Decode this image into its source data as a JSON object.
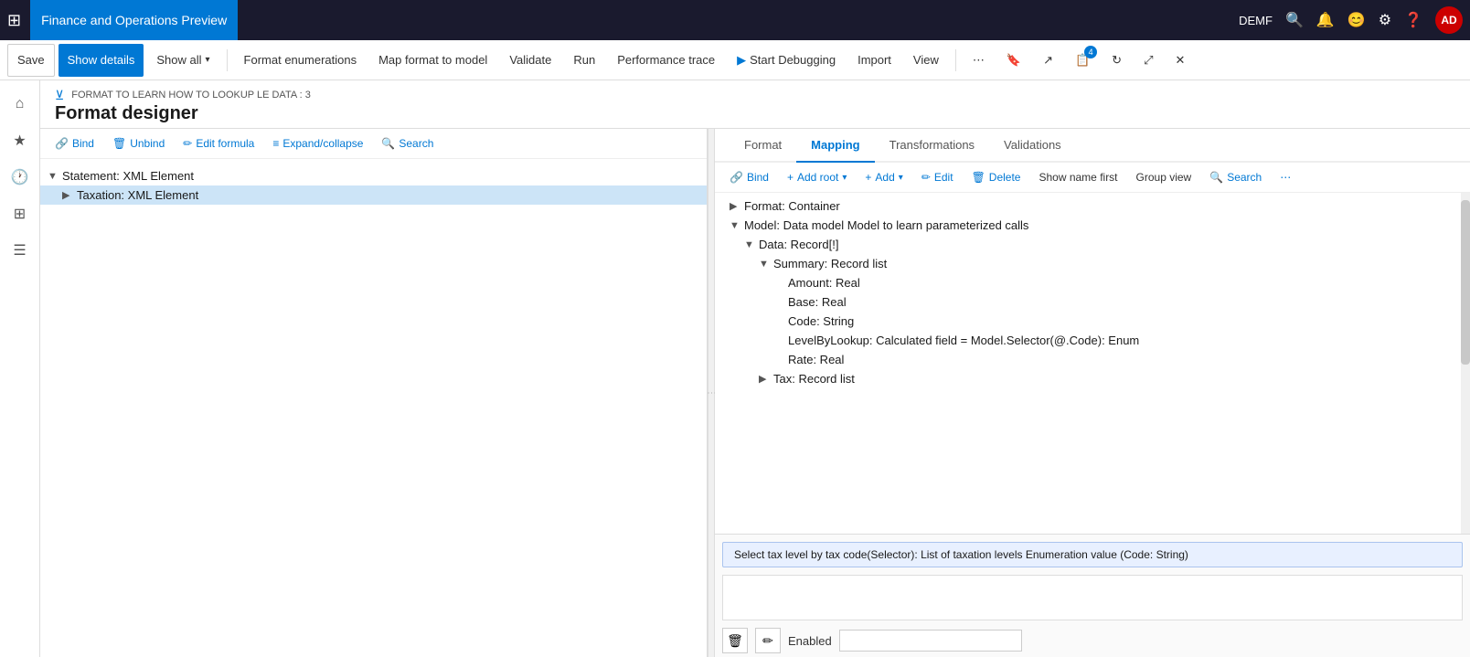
{
  "topbar": {
    "app_title": "Finance and Operations Preview",
    "tenant": "DEMF",
    "avatar": "AD"
  },
  "toolbar": {
    "save_label": "Save",
    "show_details_label": "Show details",
    "show_all_label": "Show all",
    "format_enum_label": "Format enumerations",
    "map_format_label": "Map format to model",
    "validate_label": "Validate",
    "run_label": "Run",
    "performance_label": "Performance trace",
    "debug_label": "Start Debugging",
    "import_label": "Import",
    "view_label": "View"
  },
  "page": {
    "breadcrumb": "FORMAT TO LEARN HOW TO LOOKUP LE DATA : 3",
    "title": "Format designer"
  },
  "left_panel": {
    "bind_label": "Bind",
    "unbind_label": "Unbind",
    "edit_formula_label": "Edit formula",
    "expand_collapse_label": "Expand/collapse",
    "search_label": "Search",
    "tree": [
      {
        "label": "Statement: XML Element",
        "level": 0,
        "expanded": true,
        "has_children": true
      },
      {
        "label": "Taxation: XML Element",
        "level": 1,
        "expanded": false,
        "has_children": true,
        "selected": true
      }
    ]
  },
  "tabs": [
    {
      "label": "Format",
      "active": false
    },
    {
      "label": "Mapping",
      "active": true
    },
    {
      "label": "Transformations",
      "active": false
    },
    {
      "label": "Validations",
      "active": false
    }
  ],
  "mapping_toolbar": {
    "bind_label": "Bind",
    "add_root_label": "Add root",
    "add_label": "Add",
    "edit_label": "Edit",
    "delete_label": "Delete",
    "show_name_first_label": "Show name first",
    "group_view_label": "Group view",
    "search_label": "Search"
  },
  "mapping_tree": [
    {
      "label": "Format: Container",
      "level": 0,
      "expanded": false,
      "chevron": "▶"
    },
    {
      "label": "Model: Data model Model to learn parameterized calls",
      "level": 0,
      "expanded": true,
      "chevron": "▼"
    },
    {
      "label": "Data: Record[!]",
      "level": 1,
      "expanded": true,
      "chevron": "▼"
    },
    {
      "label": "Summary: Record list",
      "level": 2,
      "expanded": true,
      "chevron": "▼"
    },
    {
      "label": "Amount: Real",
      "level": 3,
      "expanded": false,
      "chevron": ""
    },
    {
      "label": "Base: Real",
      "level": 3,
      "expanded": false,
      "chevron": ""
    },
    {
      "label": "Code: String",
      "level": 3,
      "expanded": false,
      "chevron": ""
    },
    {
      "label": "LevelByLookup: Calculated field = Model.Selector(@.Code): Enum",
      "level": 3,
      "expanded": false,
      "chevron": ""
    },
    {
      "label": "Rate: Real",
      "level": 3,
      "expanded": false,
      "chevron": ""
    },
    {
      "label": "Tax: Record list",
      "level": 2,
      "expanded": false,
      "chevron": "▶"
    }
  ],
  "selected_formula": "Select tax level by tax code(Selector): List of taxation levels Enumeration value (Code: String)",
  "enabled_label": "Enabled",
  "enabled_value": ""
}
